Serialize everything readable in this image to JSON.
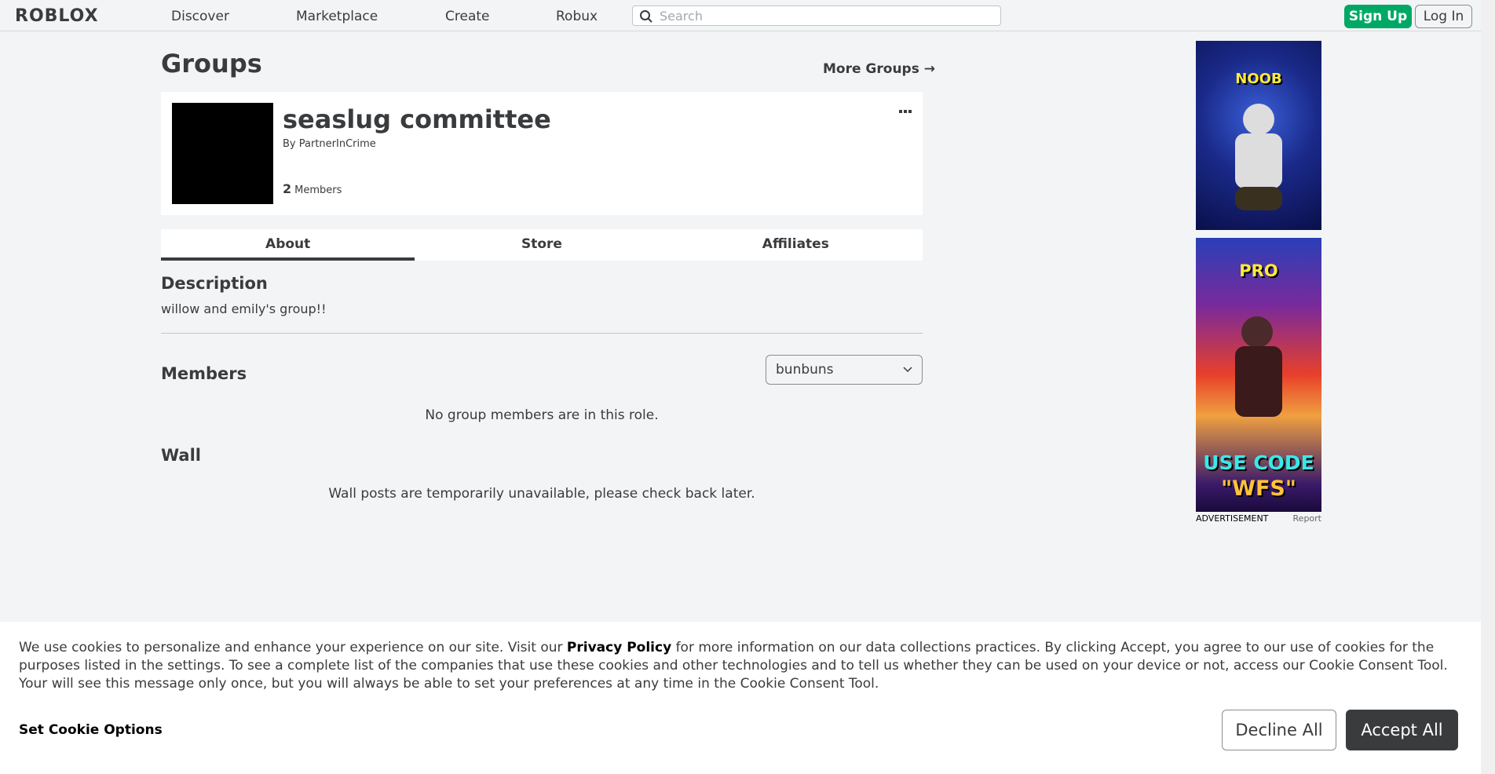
{
  "header": {
    "logo": "ROBLOX",
    "nav": [
      "Discover",
      "Marketplace",
      "Create",
      "Robux"
    ],
    "search_placeholder": "Search",
    "sign_up": "Sign Up",
    "log_in": "Log In"
  },
  "page": {
    "title": "Groups",
    "more_groups": "More Groups →"
  },
  "group": {
    "name": "seaslug committee",
    "by_label": "By",
    "owner": "PartnerInCrime",
    "member_count": "2",
    "members_label": "Members"
  },
  "tabs": [
    {
      "label": "About",
      "active": true
    },
    {
      "label": "Store",
      "active": false
    },
    {
      "label": "Affiliates",
      "active": false
    }
  ],
  "about": {
    "description_title": "Description",
    "description": "willow and emily's group!!",
    "members_title": "Members",
    "role_selected": "bunbuns",
    "no_members_msg": "No group members are in this role.",
    "wall_title": "Wall",
    "wall_msg": "Wall posts are temporarily unavailable, please check back later."
  },
  "ads": {
    "ad1_text": "NOOB",
    "ad2_text_top": "PRO",
    "ad2_text_mid": "USE CODE",
    "ad2_text_bot": "\"WFS\"",
    "label": "ADVERTISEMENT",
    "report": "Report"
  },
  "cookie": {
    "text_before": "We use cookies to personalize and enhance your experience on our site. Visit our ",
    "privacy_link": "Privacy Policy",
    "text_after": " for more information on our data collections practices. By clicking Accept, you agree to our use of cookies for the purposes listed in the settings. To see a complete list of the companies that use these cookies and other technologies and to tell us whether they can be used on your device or not, access our Cookie Consent Tool. Your will see this message only once, but you will always be able to set your preferences at any time in the Cookie Consent Tool.",
    "set_options": "Set Cookie Options",
    "decline": "Decline All",
    "accept": "Accept All"
  }
}
